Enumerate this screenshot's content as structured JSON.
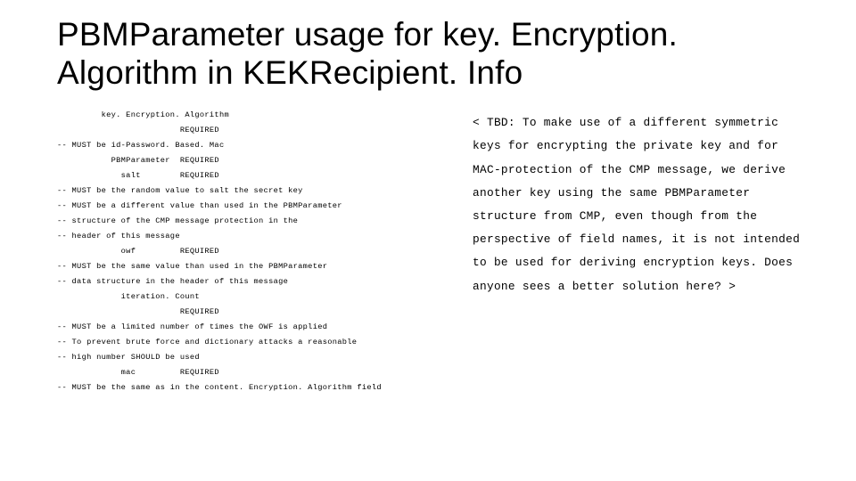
{
  "title": "PBMParameter usage for key. Encryption. Algorithm in KEKRecipient. Info",
  "left_block": "         key. Encryption. Algorithm\n                         REQUIRED\n-- MUST be id-Password. Based. Mac\n           PBMParameter  REQUIRED\n             salt        REQUIRED\n-- MUST be the random value to salt the secret key\n-- MUST be a different value than used in the PBMParameter\n-- structure of the CMP message protection in the\n-- header of this message\n             owf         REQUIRED\n-- MUST be the same value than used in the PBMParameter\n-- data structure in the header of this message\n             iteration. Count\n                         REQUIRED\n-- MUST be a limited number of times the OWF is applied\n-- To prevent brute force and dictionary attacks a reasonable\n-- high number SHOULD be used\n             mac         REQUIRED\n-- MUST be the same as in the content. Encryption. Algorithm field",
  "right_block": " < TBD: To make use of a different symmetric keys for encrypting the private key and for MAC-protection of the CMP message, we derive another key using the same PBMParameter structure from CMP, even though from the perspective of field names, it is not intended to be used for deriving encryption keys.  Does anyone sees a better solution here? >"
}
